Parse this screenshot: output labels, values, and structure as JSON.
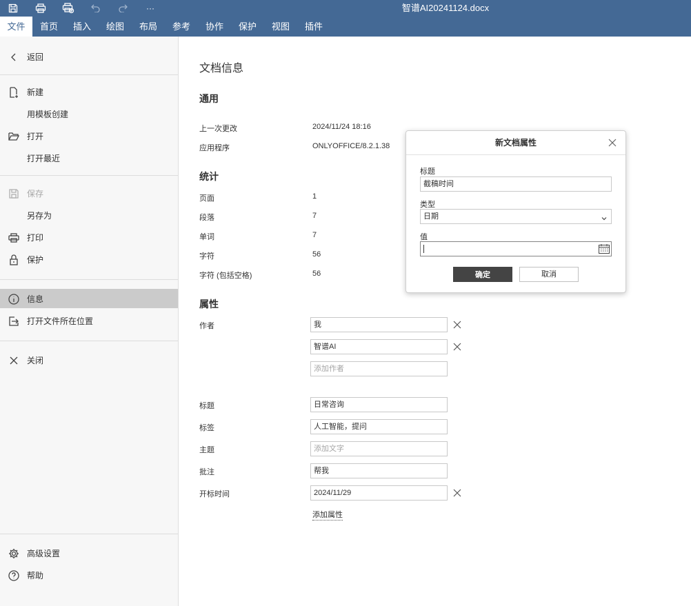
{
  "window": {
    "title": "智谱AI20241124.docx"
  },
  "toolbar": {
    "icons": [
      "save-icon",
      "print-icon",
      "quick-print-icon",
      "undo-icon",
      "redo-icon",
      "more-icon"
    ],
    "more_label": "···"
  },
  "menu": {
    "tabs": [
      {
        "label": "文件",
        "active": true
      },
      {
        "label": "首页"
      },
      {
        "label": "插入"
      },
      {
        "label": "绘图"
      },
      {
        "label": "布局"
      },
      {
        "label": "参考"
      },
      {
        "label": "协作"
      },
      {
        "label": "保护"
      },
      {
        "label": "视图"
      },
      {
        "label": "插件"
      }
    ]
  },
  "sidebar": {
    "back": "返回",
    "new": "新建",
    "from_template": "用模板创建",
    "open": "打开",
    "open_recent": "打开最近",
    "save": "保存",
    "save_as": "另存为",
    "print": "打印",
    "protect": "保护",
    "info": "信息",
    "open_location": "打开文件所在位置",
    "close": "关闭",
    "advanced_settings": "高级设置",
    "help": "帮助"
  },
  "info": {
    "page_title": "文档信息",
    "general": {
      "heading": "通用",
      "last_modified_label": "上一次更改",
      "last_modified_value": "2024/11/24 18:16",
      "application_label": "应用程序",
      "application_value": "ONLYOFFICE/8.2.1.38"
    },
    "statistics": {
      "heading": "统计",
      "pages_label": "页面",
      "pages_value": "1",
      "paragraphs_label": "段落",
      "paragraphs_value": "7",
      "words_label": "单词",
      "words_value": "7",
      "chars_label": "字符",
      "chars_value": "56",
      "chars_spaces_label": "字符 (包括空格)",
      "chars_spaces_value": "56"
    },
    "properties": {
      "heading": "属性",
      "author_label": "作者",
      "authors": [
        "我",
        "智谱AI"
      ],
      "add_author_placeholder": "添加作者",
      "title_label": "标题",
      "title_value": "日常咨询",
      "tags_label": "标签",
      "tags_value": "人工智能，提问",
      "subject_label": "主题",
      "subject_placeholder": "添加文字",
      "comment_label": "批注",
      "comment_value": "帮我",
      "custom_label": "开标时间",
      "custom_value": "2024/11/29",
      "add_property": "添加属性"
    }
  },
  "dialog": {
    "title": "新文档属性",
    "title_label": "标题",
    "title_value": "截稿时间",
    "type_label": "类型",
    "type_value": "日期",
    "value_label": "值",
    "value_value": "",
    "ok": "确定",
    "cancel": "取消"
  },
  "colors": {
    "header": "#446995",
    "sidebar_selected": "#cbcbcb",
    "ok_button": "#444444"
  }
}
